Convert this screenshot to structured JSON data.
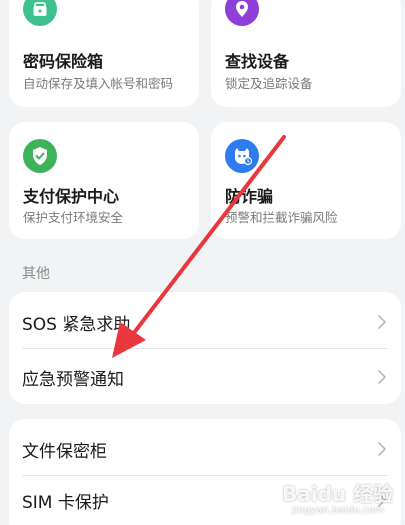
{
  "tiles": [
    {
      "title": "密码保险箱",
      "subtitle": "自动保存及填入帐号和密码",
      "icon": "lock-box-icon",
      "icon_color": "#3fc18f"
    },
    {
      "title": "查找设备",
      "subtitle": "锁定及追踪设备",
      "icon": "location-pin-icon",
      "icon_color": "#8e3fd8"
    },
    {
      "title": "支付保护中心",
      "subtitle": "保护支付环境安全",
      "icon": "shield-check-icon",
      "icon_color": "#3fb35a"
    },
    {
      "title": "防诈骗",
      "subtitle": "预警和拦截诈骗风险",
      "icon": "anti-fraud-icon",
      "icon_color": "#2f7bf0"
    }
  ],
  "section": {
    "label": "其他"
  },
  "list_group_1": [
    {
      "label": "SOS 紧急求助"
    },
    {
      "label": "应急预警通知"
    }
  ],
  "list_group_2": [
    {
      "label": "文件保密柜"
    },
    {
      "label": "SIM 卡保护"
    }
  ],
  "annotation": {
    "arrow_color": "#e8383d"
  },
  "watermark": {
    "text": "Baidu 经验",
    "sub": "jingyan.baidu.com"
  }
}
